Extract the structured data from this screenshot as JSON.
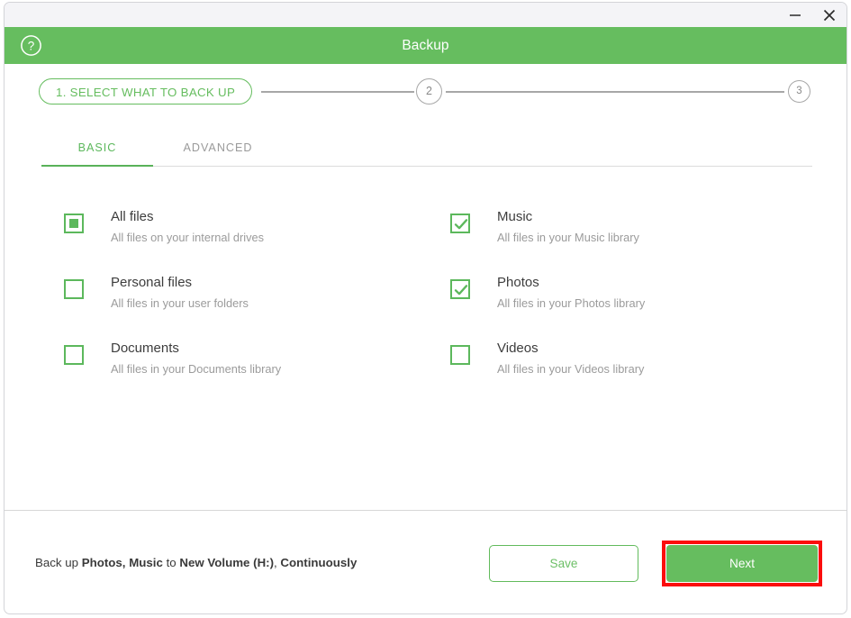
{
  "window": {
    "titlebar": {
      "minimize_label": "−",
      "close_label": "×",
      "minimize_icon": "minimize-icon",
      "close_icon": "close-icon"
    },
    "app_title": "Backup",
    "help_icon": "help-question-icon"
  },
  "stepper": {
    "step1_label": "1. SELECT WHAT TO BACK UP",
    "step2_label": "2",
    "step3_label": "3"
  },
  "tabs": [
    {
      "label": "BASIC",
      "active": true
    },
    {
      "label": "ADVANCED",
      "active": false
    }
  ],
  "options": {
    "left": [
      {
        "title": "All files",
        "subtitle": "All files on your internal drives",
        "state": "partial",
        "icon": "checkbox-partial-icon"
      },
      {
        "title": "Personal files",
        "subtitle": "All files in your user folders",
        "state": "unchecked",
        "icon": "checkbox-unchecked-icon"
      },
      {
        "title": "Documents",
        "subtitle": "All files in your Documents library",
        "state": "unchecked",
        "icon": "checkbox-unchecked-icon"
      }
    ],
    "right": [
      {
        "title": "Music",
        "subtitle": "All files in your Music library",
        "state": "checked",
        "icon": "checkbox-checked-icon"
      },
      {
        "title": "Photos",
        "subtitle": "All files in your Photos library",
        "state": "checked",
        "icon": "checkbox-checked-icon"
      },
      {
        "title": "Videos",
        "subtitle": "All files in your Videos library",
        "state": "unchecked",
        "icon": "checkbox-unchecked-icon"
      }
    ]
  },
  "footer": {
    "summary_parts": [
      {
        "text": "Back up ",
        "bold": false
      },
      {
        "text": "Photos, Music",
        "bold": true
      },
      {
        "text": " to ",
        "bold": false
      },
      {
        "text": "New Volume (H:)",
        "bold": true
      },
      {
        "text": ", ",
        "bold": false
      },
      {
        "text": "Continuously",
        "bold": true
      }
    ],
    "summary_plain": "Back up Photos, Music to New Volume (H:), Continuously",
    "save_label": "Save",
    "next_label": "Next"
  },
  "colors": {
    "brand_green": "#66bd5f",
    "checkbox_green": "#5cb85c",
    "highlight_red": "#fb0d0d",
    "titlebar_bg": "#f4f4f7",
    "text_dark": "#3d3d3d",
    "text_muted": "#9b9b9b",
    "stepper_gray": "#a7a7a7"
  }
}
